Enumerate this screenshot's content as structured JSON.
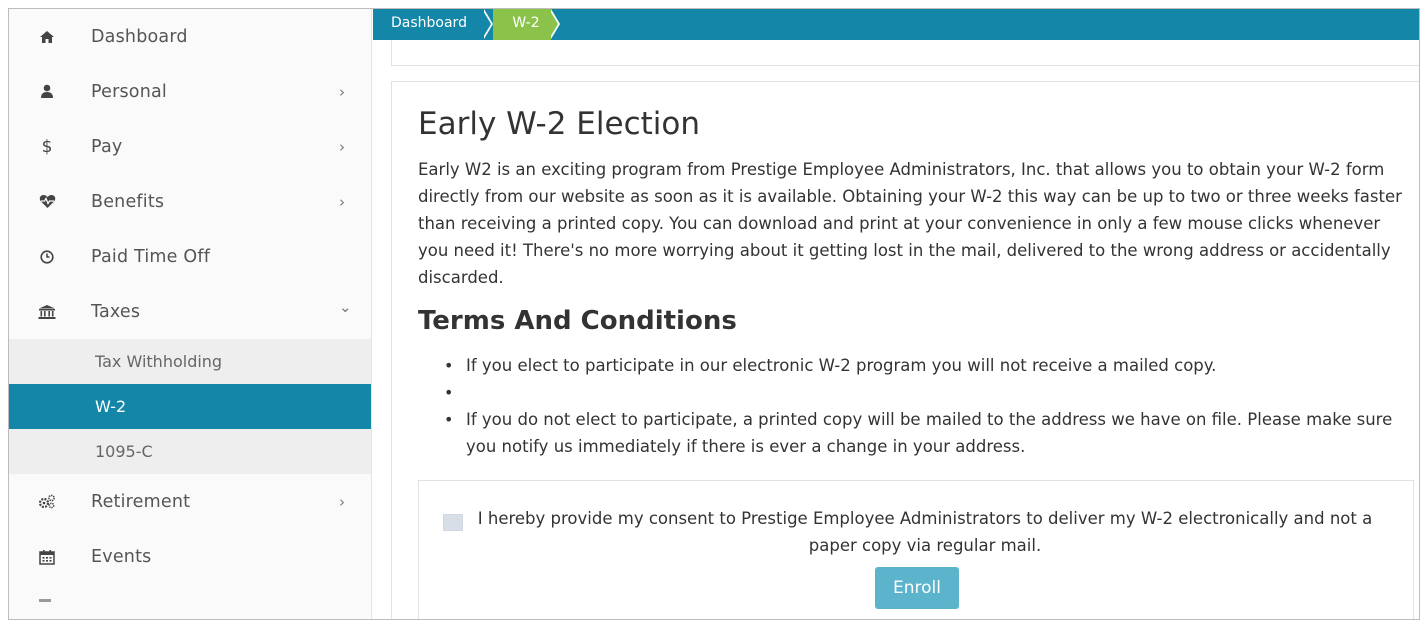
{
  "sidebar": {
    "items": [
      {
        "label": "Dashboard",
        "icon": "home-icon",
        "chevron": ""
      },
      {
        "label": "Personal",
        "icon": "user-icon",
        "chevron": "›"
      },
      {
        "label": "Pay",
        "icon": "dollar-icon",
        "chevron": "›"
      },
      {
        "label": "Benefits",
        "icon": "heartbeat-icon",
        "chevron": "›"
      },
      {
        "label": "Paid Time Off",
        "icon": "clock-icon",
        "chevron": ""
      },
      {
        "label": "Taxes",
        "icon": "bank-icon",
        "chevron": "⌄"
      }
    ],
    "subitems": [
      {
        "label": "Tax Withholding",
        "active": false
      },
      {
        "label": "W-2",
        "active": true
      },
      {
        "label": "1095-C",
        "active": false
      }
    ],
    "items_after": [
      {
        "label": "Retirement",
        "icon": "gears-icon",
        "chevron": "›"
      },
      {
        "label": "Events",
        "icon": "calendar-icon",
        "chevron": ""
      }
    ]
  },
  "breadcrumb": {
    "items": [
      "Dashboard",
      "W-2"
    ]
  },
  "main": {
    "title": "Early W-2 Election",
    "intro": "Early W2 is an exciting program from Prestige Employee Administrators, Inc. that allows you to obtain your W-2 form directly from our website as soon as it is available. Obtaining your W-2 this way can be up to two or three weeks faster than receiving a printed copy. You can download and print at your convenience in only a few mouse clicks whenever you need it! There's no more worrying about it getting lost in the mail, delivered to the wrong address or accidentally discarded.",
    "terms_title": "Terms And Conditions",
    "terms": [
      "If you elect to participate in our electronic W-2 program you will not receive a mailed copy.",
      "",
      "If you do not elect to participate, a printed copy will be mailed to the address we have on file. Please make sure you notify us immediately if there is ever a change in your address."
    ],
    "consent_text": "I hereby provide my consent to Prestige Employee Administrators to deliver my W-2 electronically and not a paper copy via regular mail.",
    "enroll_label": "Enroll"
  },
  "colors": {
    "accent": "#1487a9",
    "breadcrumb_active": "#8bc34a",
    "button": "#5bb3cc"
  }
}
